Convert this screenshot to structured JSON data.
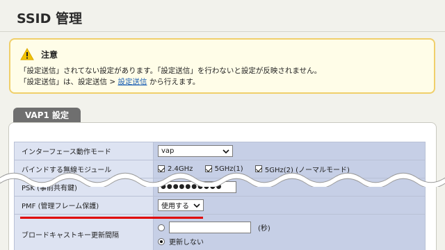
{
  "page": {
    "title": "SSID 管理"
  },
  "notice": {
    "title": "注意",
    "line1": "「設定送信」されてない設定があります。「設定送信」を行わないと設定が反映されません。",
    "line2_prefix": "「設定送信」は、設定送信 > ",
    "line2_link": "設定送信",
    "line2_suffix": " から行えます。",
    "icon": "warning-icon"
  },
  "section": {
    "tab_label": "VAP1 設定"
  },
  "settings": {
    "interface_mode": {
      "label": "インターフェース動作モード",
      "value": "vap"
    },
    "radio_module": {
      "label": "バインドする無線モジュール",
      "options": [
        "2.4GHz",
        "5GHz(1)",
        "5GHz(2) (ノーマルモード)"
      ],
      "checked": [
        true,
        true,
        true
      ]
    },
    "psk": {
      "label": "PSK (事前共有鍵)",
      "value": "●●●●●●●●●●"
    },
    "pmf": {
      "label": "PMF (管理フレーム保護)",
      "value": "使用する"
    },
    "broadcast_key": {
      "label": "ブロードキャストキー更新間隔",
      "unit": "(秒)",
      "no_update_label": "更新しない",
      "selected": "no_update"
    }
  },
  "colors": {
    "accent_highlight": "#e00000",
    "link": "#1a5fb4",
    "notice_border": "#f0cf6a"
  }
}
